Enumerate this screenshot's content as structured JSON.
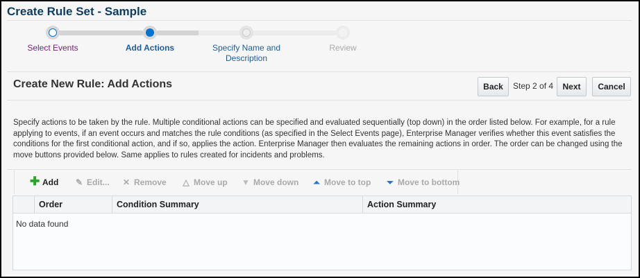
{
  "title": "Create Rule Set - Sample",
  "train": {
    "steps": [
      {
        "label": "Select Events",
        "state": "visited"
      },
      {
        "label": "Add Actions",
        "state": "current"
      },
      {
        "label": "Specify Name and Description",
        "state": "next"
      },
      {
        "label": "Review",
        "state": "disabled"
      }
    ]
  },
  "heading": "Create New Rule: Add Actions",
  "nav": {
    "back": "Back",
    "step": "Step 2 of 4",
    "next": "Next",
    "cancel": "Cancel"
  },
  "description": "Specify actions to be taken by the rule. Multiple conditional actions can be specified and evaluated sequentially (top down) in the order listed below. For example, for a rule applying to events, if an event occurs and matches the rule conditions (as specified in the Select Events page), Enterprise Manager verifies whether this event satisfies the conditions for the first conditional action, and if so, applies the action. Enterprise Manager then evaluates the remaining actions in order. The order can be changed using the move buttons provided below. Same applies to rules created for incidents and problems.",
  "toolbar": {
    "add": "Add",
    "edit": "Edit...",
    "remove": "Remove",
    "move_up": "Move up",
    "move_down": "Move down",
    "move_top": "Move to top",
    "move_bottom": "Move to bottom"
  },
  "table": {
    "columns": [
      "Order",
      "Condition Summary",
      "Action Summary"
    ],
    "empty": "No data found"
  },
  "colors": {
    "title": "#0d3c5e",
    "current": "#0572ce",
    "visited": "#7a1e74",
    "link": "#1f5d99"
  }
}
